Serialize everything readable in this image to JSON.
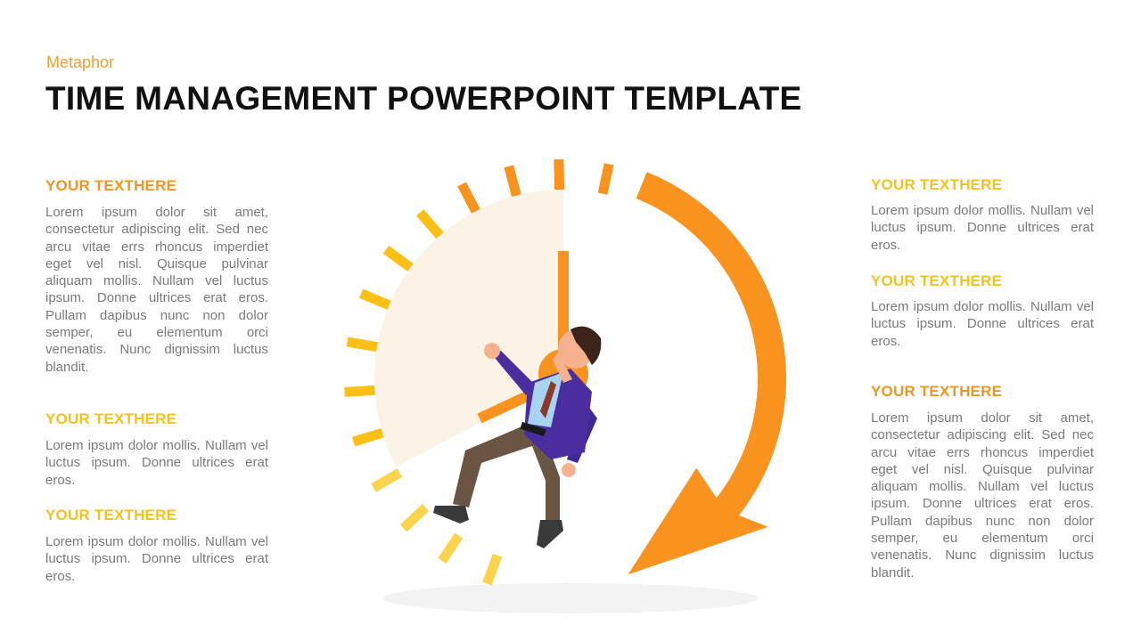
{
  "header": {
    "subtitle": "Metaphor",
    "title": "TIME MANAGEMENT POWERPOINT TEMPLATE"
  },
  "colors": {
    "orange": "#f7931e",
    "yellow": "#fbbf16",
    "light_yellow": "#fcd34d",
    "sector": "#fbf3e6",
    "suit": "#4a2ea0",
    "heading_orange": "#f0961e",
    "heading_yellow": "#f5c21a",
    "body_text": "#7a7a7a"
  },
  "left_blocks": [
    {
      "heading": "YOUR TEXTHERE",
      "body": "Lorem ipsum dolor sit amet, consectetur adipiscing elit. Sed nec arcu vitae errs rhoncus imperdiet eget vel nisl. Quisque pulvinar aliquam mollis. Nullam vel luctus ipsum. Donne ultrices erat eros. Pullam dapibus nunc non dolor semper, eu elementum orci venenatis. Nunc dignissim luctus blandit."
    },
    {
      "heading": "YOUR TEXTHERE",
      "body": "Lorem ipsum dolor mollis. Nullam vel luctus ipsum. Donne ultrices erat eros."
    },
    {
      "heading": "YOUR TEXTHERE",
      "body": "Lorem ipsum dolor mollis. Nullam vel luctus ipsum. Donne ultrices erat eros."
    }
  ],
  "right_blocks": [
    {
      "heading": "YOUR TEXTHERE",
      "body": "Lorem ipsum dolor mollis. Nullam vel luctus ipsum. Donne ultrices erat eros."
    },
    {
      "heading": "YOUR TEXTHERE",
      "body": "Lorem ipsum dolor mollis. Nullam vel luctus ipsum. Donne ultrices erat eros."
    },
    {
      "heading": "YOUR TEXTHERE",
      "body": "Lorem ipsum dolor sit amet, consectetur adipiscing elit. Sed nec arcu vitae errs rhoncus imperdiet eget vel nisl. Quisque pulvinar aliquam mollis. Nullam vel luctus ipsum. Donne ultrices erat eros. Pullam dapibus nunc non dolor semper, eu elementum orci venenatis. Nunc dignissim luctus blandit."
    }
  ],
  "illustration": {
    "name": "businessman running from clock",
    "clock_ticks": 14
  }
}
